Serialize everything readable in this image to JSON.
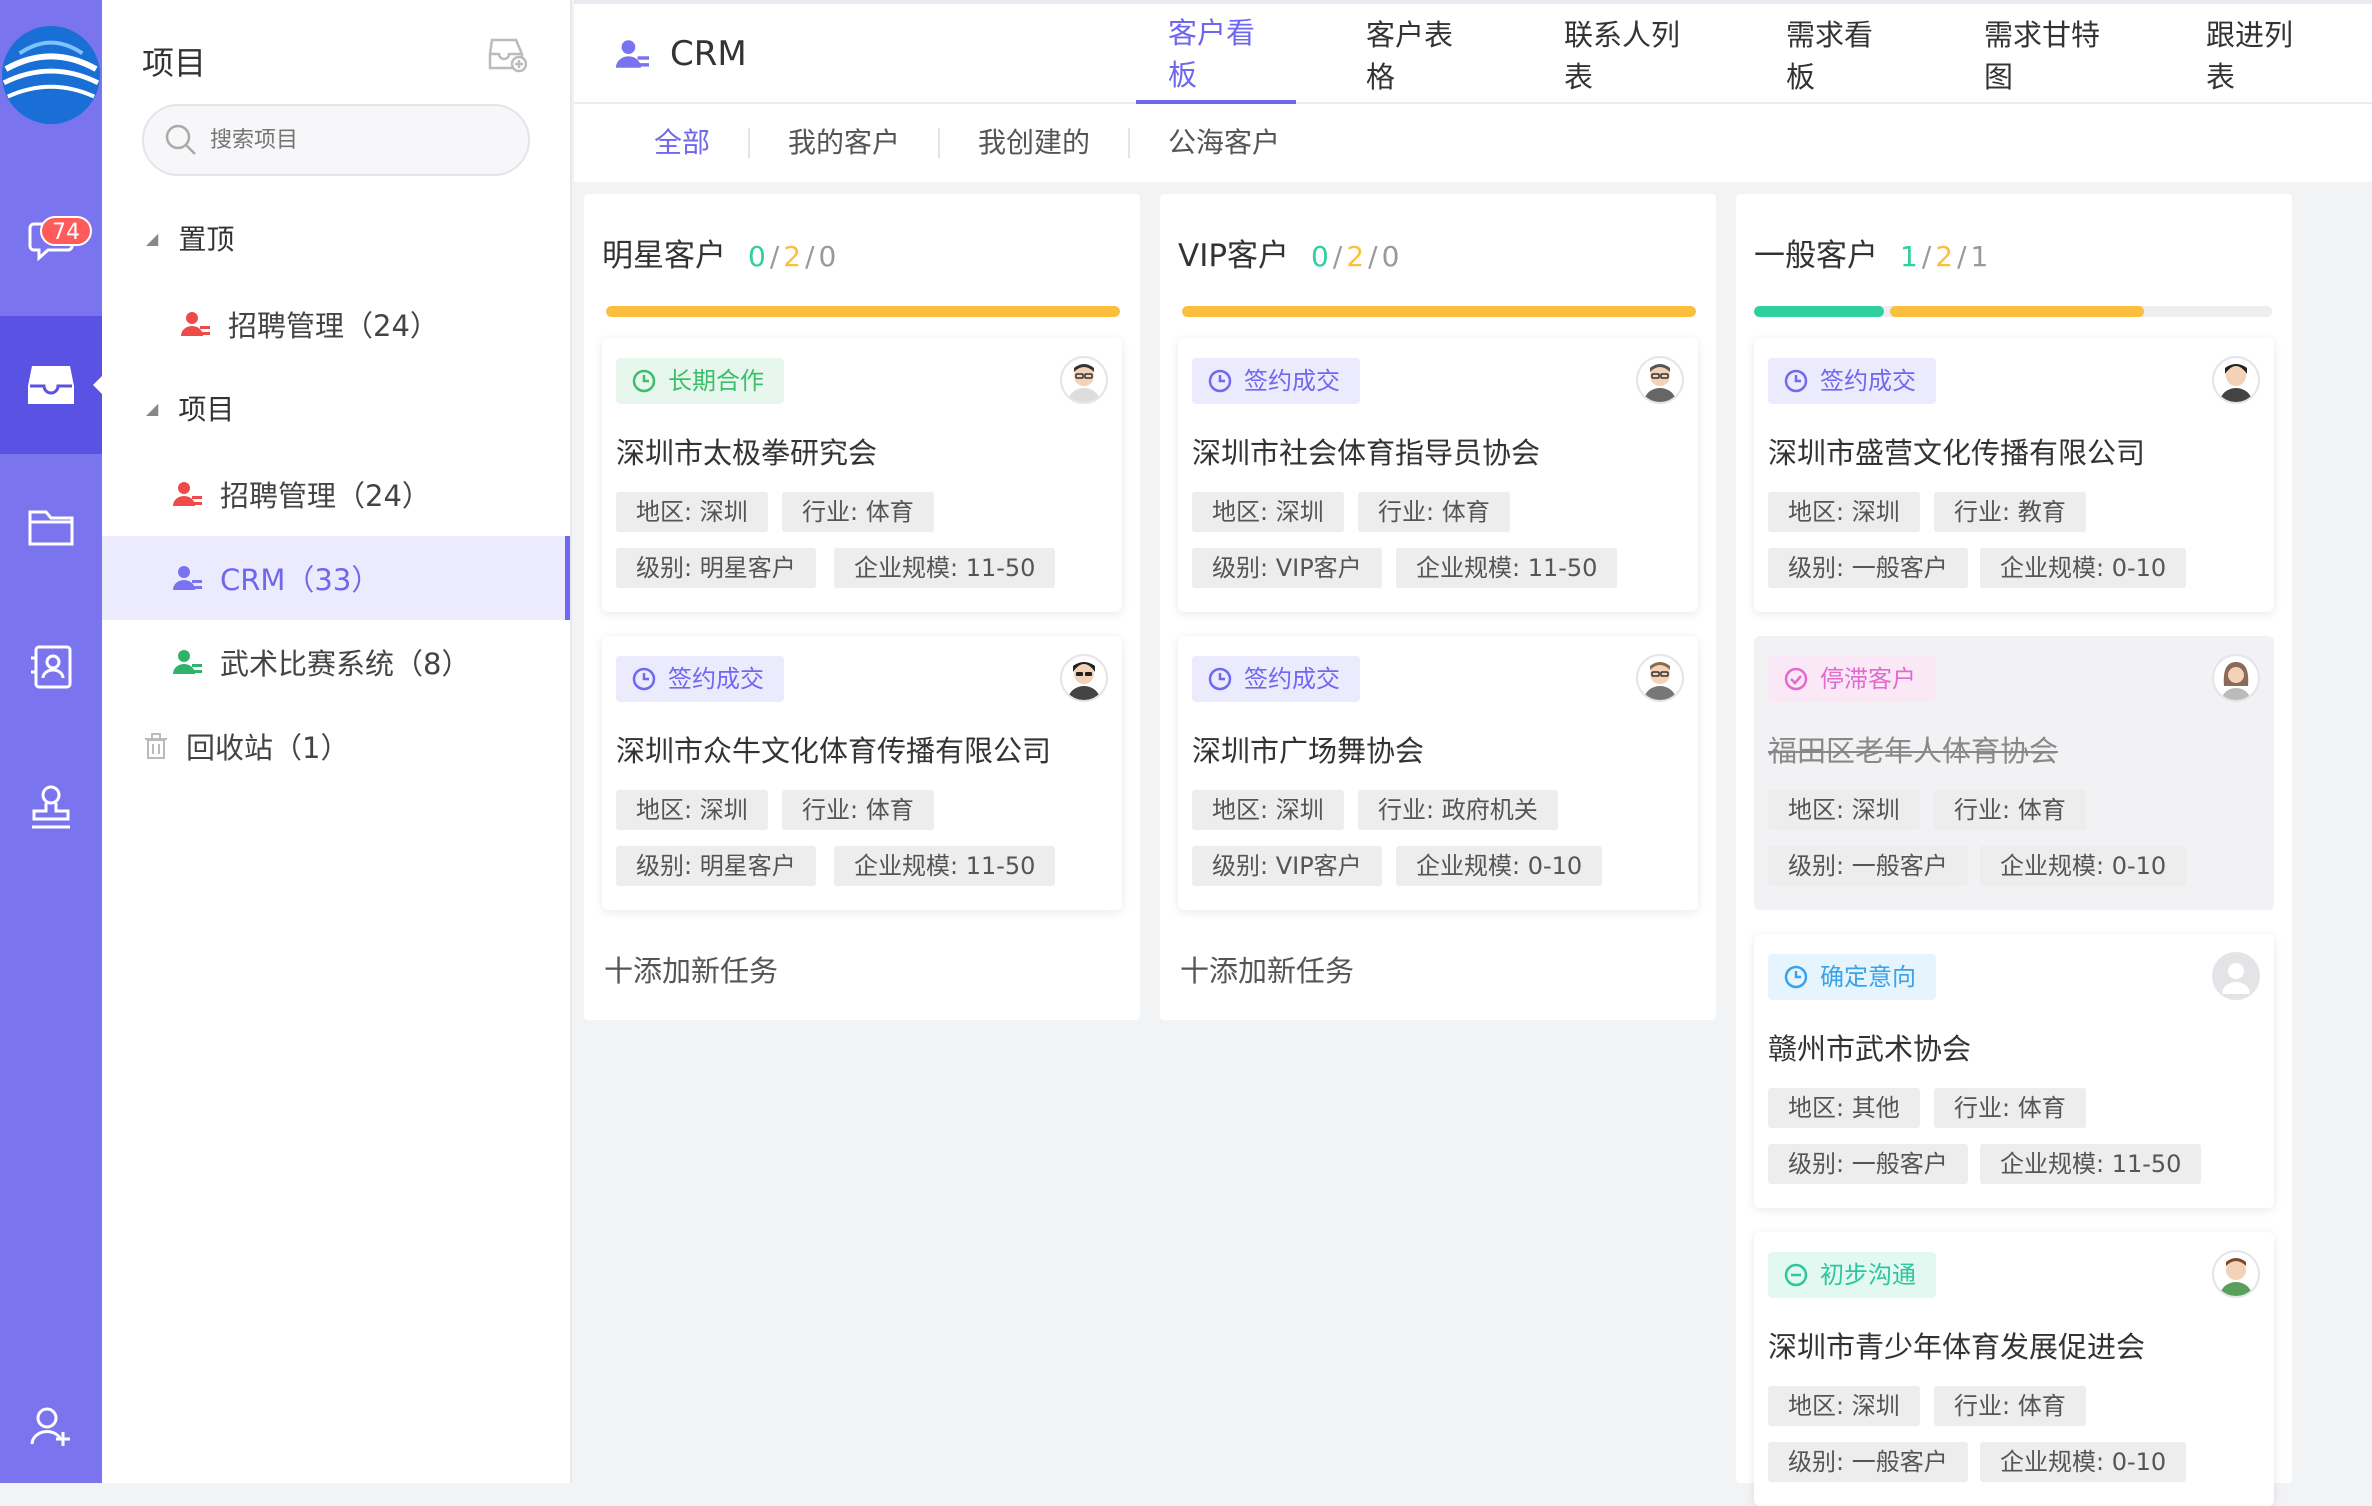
{
  "nav": {
    "unread_badge": "74"
  },
  "sidebar": {
    "title": "项目",
    "search_placeholder": "搜索项目",
    "pinned_label": "置顶",
    "pinned_items": [
      {
        "label": "招聘管理（24）",
        "icon_color": "#ee4a4a"
      }
    ],
    "projects_label": "项目",
    "project_items": [
      {
        "label": "招聘管理（24）",
        "icon_color": "#ee4a4a"
      },
      {
        "label": "CRM（33）",
        "icon_color": "#7a73ef"
      },
      {
        "label": "武术比赛系统（8）",
        "icon_color": "#2fb36a"
      }
    ],
    "recycle_label": "回收站（1）"
  },
  "header": {
    "project_name": "CRM",
    "tabs": [
      "客户看板",
      "客户表格",
      "联系人列表",
      "需求看板",
      "需求甘特图",
      "跟进列表"
    ],
    "active_tab": "客户看板",
    "subtabs": [
      "全部",
      "我的客户",
      "我创建的",
      "公海客户"
    ],
    "active_subtab": "全部"
  },
  "board": {
    "add_task_label": "十添加新任务",
    "columns": [
      {
        "title": "明星客户",
        "count_green": "0",
        "count_orange": "2",
        "count_gray": "0",
        "cards": [
          {
            "status": "长期合作",
            "status_type": "green",
            "name": "深圳市太极拳研究会",
            "region": "地区: 深圳",
            "industry": "行业: 体育",
            "level": "级别: 明星客户",
            "size": "企业规模: 11-50"
          },
          {
            "status": "签约成交",
            "status_type": "purple",
            "name": "深圳市众牛文化体育传播有限公司",
            "region": "地区: 深圳",
            "industry": "行业: 体育",
            "level": "级别: 明星客户",
            "size": "企业规模: 11-50"
          }
        ]
      },
      {
        "title": "VIP客户",
        "count_green": "0",
        "count_orange": "2",
        "count_gray": "0",
        "cards": [
          {
            "status": "签约成交",
            "status_type": "purple",
            "name": "深圳市社会体育指导员协会",
            "region": "地区: 深圳",
            "industry": "行业: 体育",
            "level": "级别: VIP客户",
            "size": "企业规模: 11-50"
          },
          {
            "status": "签约成交",
            "status_type": "purple",
            "name": "深圳市广场舞协会",
            "region": "地区: 深圳",
            "industry": "行业: 政府机关",
            "level": "级别: VIP客户",
            "size": "企业规模: 0-10"
          }
        ]
      },
      {
        "title": "一般客户",
        "count_green": "1",
        "count_orange": "2",
        "count_gray": "1",
        "cards": [
          {
            "status": "签约成交",
            "status_type": "purple",
            "name": "深圳市盛营文化传播有限公司",
            "region": "地区: 深圳",
            "industry": "行业: 教育",
            "level": "级别: 一般客户",
            "size": "企业规模: 0-10"
          },
          {
            "status": "停滞客户",
            "status_type": "pink",
            "name": "福田区老年人体育协会",
            "region": "地区: 深圳",
            "industry": "行业: 体育",
            "level": "级别: 一般客户",
            "size": "企业规模: 0-10"
          },
          {
            "status": "确定意向",
            "status_type": "blue",
            "name": "赣州市武术协会",
            "region": "地区: 其他",
            "industry": "行业: 体育",
            "level": "级别: 一般客户",
            "size": "企业规模: 11-50"
          },
          {
            "status": "初步沟通",
            "status_type": "teal",
            "name": "深圳市青少年体育发展促进会",
            "region": "地区: 深圳",
            "industry": "行业: 体育",
            "level": "级别: 一般客户",
            "size": "企业规模: 0-10"
          }
        ]
      }
    ]
  },
  "colors": {
    "brand": "#7b74ef",
    "accent": "#6f67ee",
    "progress_green": "#2fcfa0",
    "progress_orange": "#fbbe3e"
  }
}
